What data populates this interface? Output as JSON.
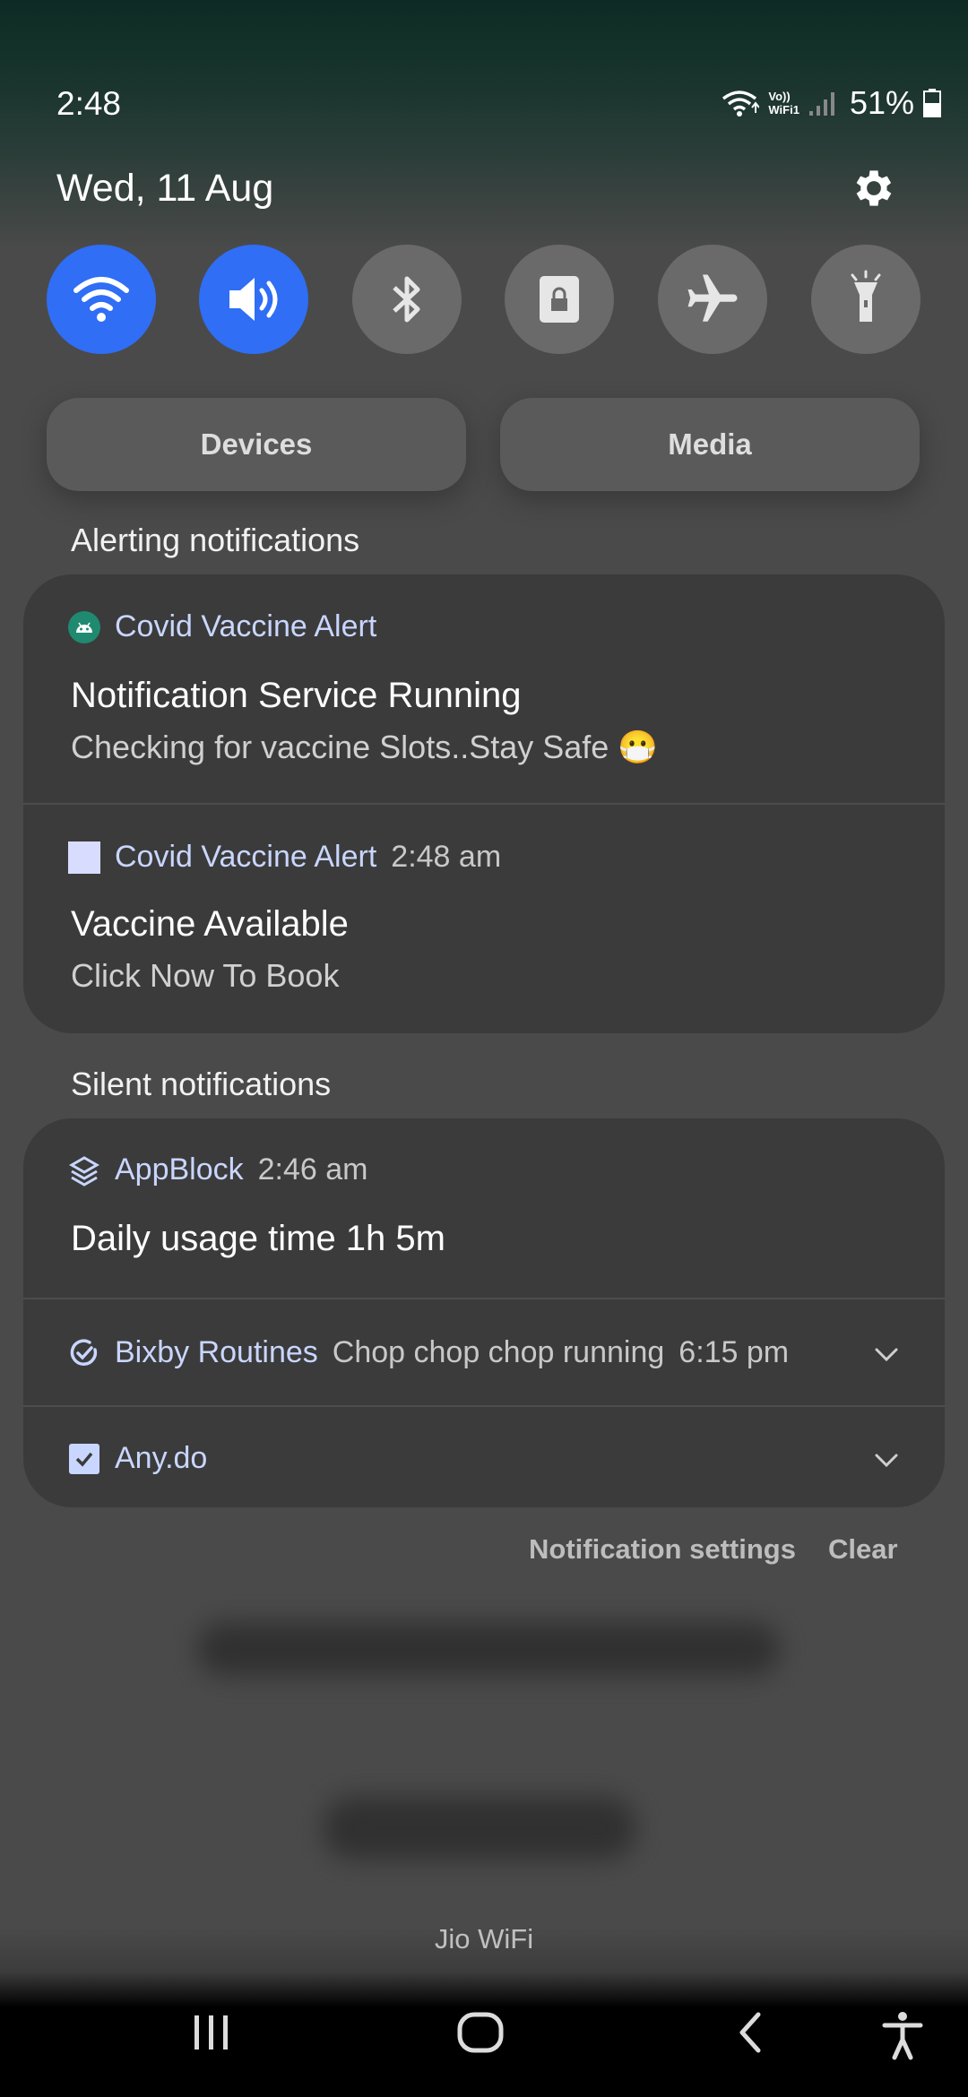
{
  "status_bar": {
    "time": "2:48",
    "battery_percent": "51%",
    "vowifi_top": "Vo))",
    "vowifi_bottom": "WiFi1"
  },
  "date": "Wed, 11 Aug",
  "quick_toggles": [
    {
      "name": "wifi",
      "state": "on"
    },
    {
      "name": "sound",
      "state": "on"
    },
    {
      "name": "bluetooth",
      "state": "off"
    },
    {
      "name": "screen-lock",
      "state": "off"
    },
    {
      "name": "airplane-mode",
      "state": "off"
    },
    {
      "name": "flashlight",
      "state": "off"
    }
  ],
  "buttons": {
    "devices": "Devices",
    "media": "Media"
  },
  "alerting": {
    "title": "Alerting notifications",
    "items": [
      {
        "app": "Covid Vaccine Alert",
        "time": "",
        "title": "Notification Service Running",
        "text": "Checking for vaccine Slots..Stay Safe 😷"
      },
      {
        "app": "Covid Vaccine Alert",
        "time": "2:48 am",
        "title": "Vaccine Available",
        "text": "Click Now To Book"
      }
    ]
  },
  "silent": {
    "title": "Silent notifications",
    "items": [
      {
        "app": "AppBlock",
        "time": "2:46 am",
        "title": "Daily usage time 1h 5m"
      },
      {
        "app": "Bixby Routines",
        "summary": "Chop chop chop running",
        "time": "6:15 pm"
      },
      {
        "app": "Any.do"
      }
    ]
  },
  "actions": {
    "settings": "Notification settings",
    "clear": "Clear"
  },
  "carrier": "Jio WiFi",
  "colors": {
    "accent": "#2f6ef5",
    "card": "#3b3b3b",
    "app_name": "#c9d6ff"
  }
}
